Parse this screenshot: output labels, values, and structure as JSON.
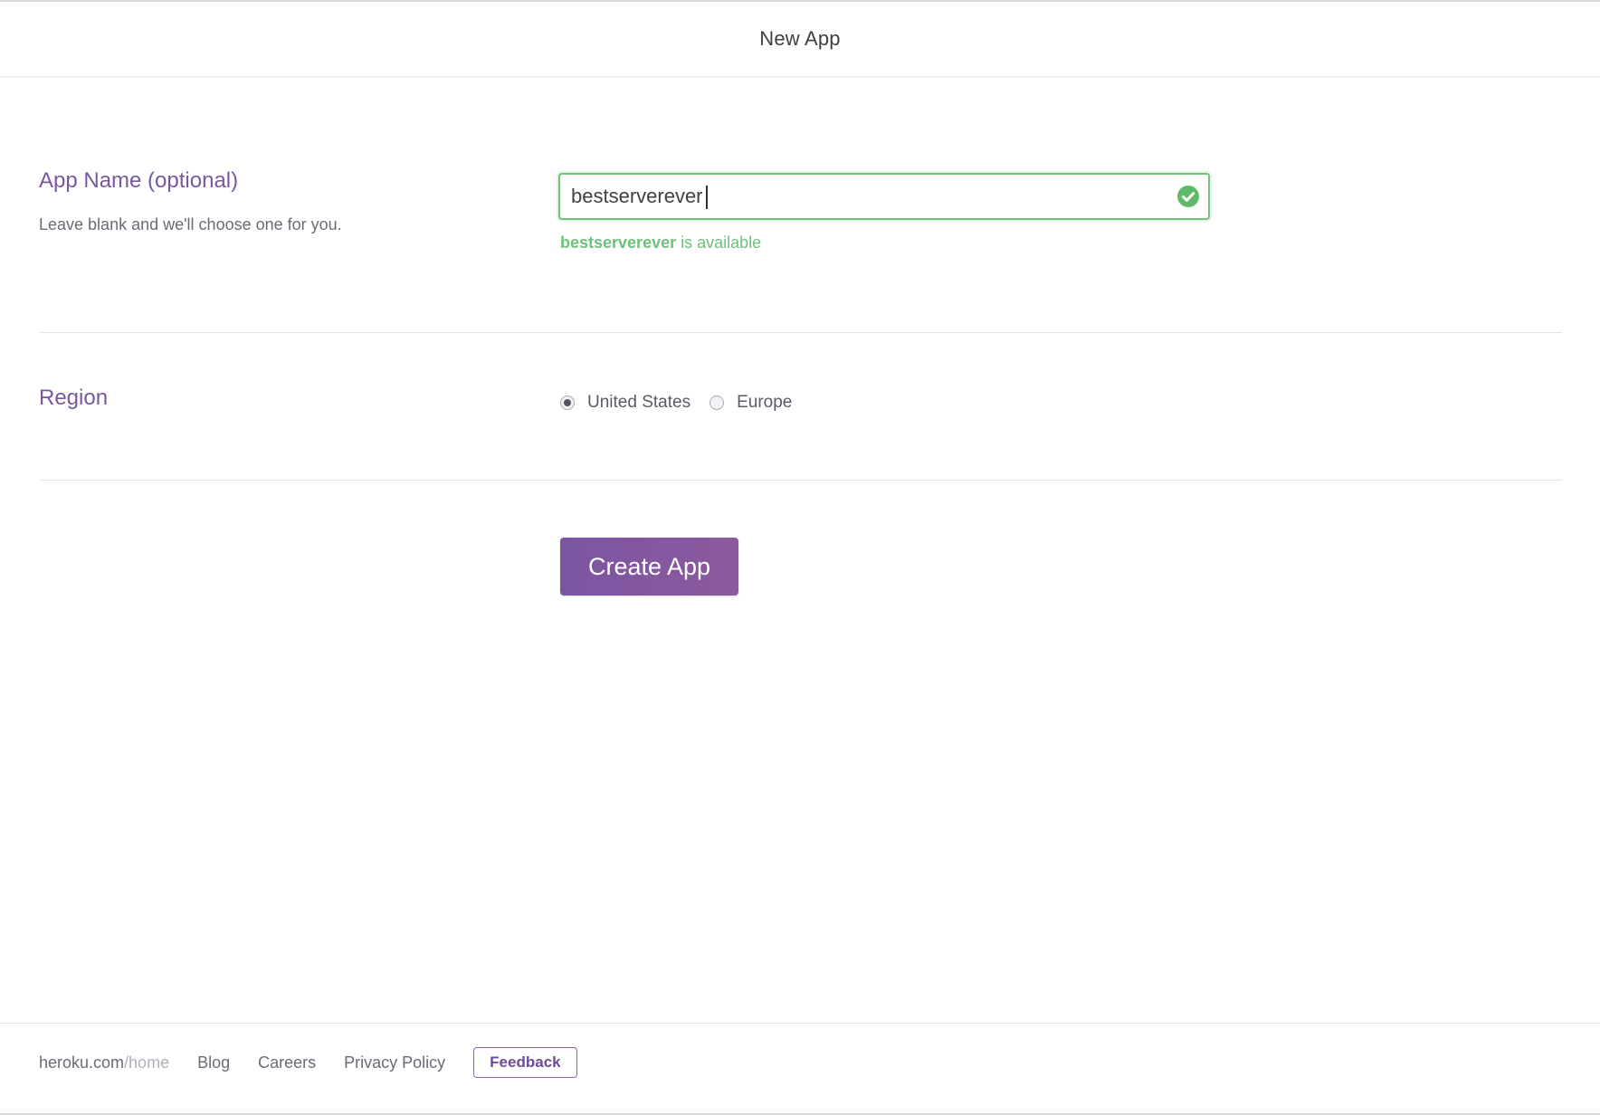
{
  "header": {
    "title": "New App"
  },
  "app_name": {
    "label": "App Name (optional)",
    "hint": "Leave blank and we'll choose one for you.",
    "input_value": "bestserverever",
    "availability_name": "bestserverever",
    "availability_text": " is available"
  },
  "region": {
    "label": "Region",
    "options": [
      {
        "label": "United States",
        "selected": true
      },
      {
        "label": "Europe",
        "selected": false
      }
    ]
  },
  "actions": {
    "create_label": "Create App"
  },
  "footer": {
    "home_domain": "heroku.com",
    "home_path": "/home",
    "links": [
      "Blog",
      "Careers",
      "Privacy Policy"
    ],
    "feedback_label": "Feedback"
  },
  "colors": {
    "accent_purple": "#79589f",
    "success_green": "#74c27c",
    "button_gradient_start": "#7b55a2",
    "button_gradient_end": "#8c5a9e"
  },
  "icons": {
    "input_status": "check-circle-icon"
  }
}
